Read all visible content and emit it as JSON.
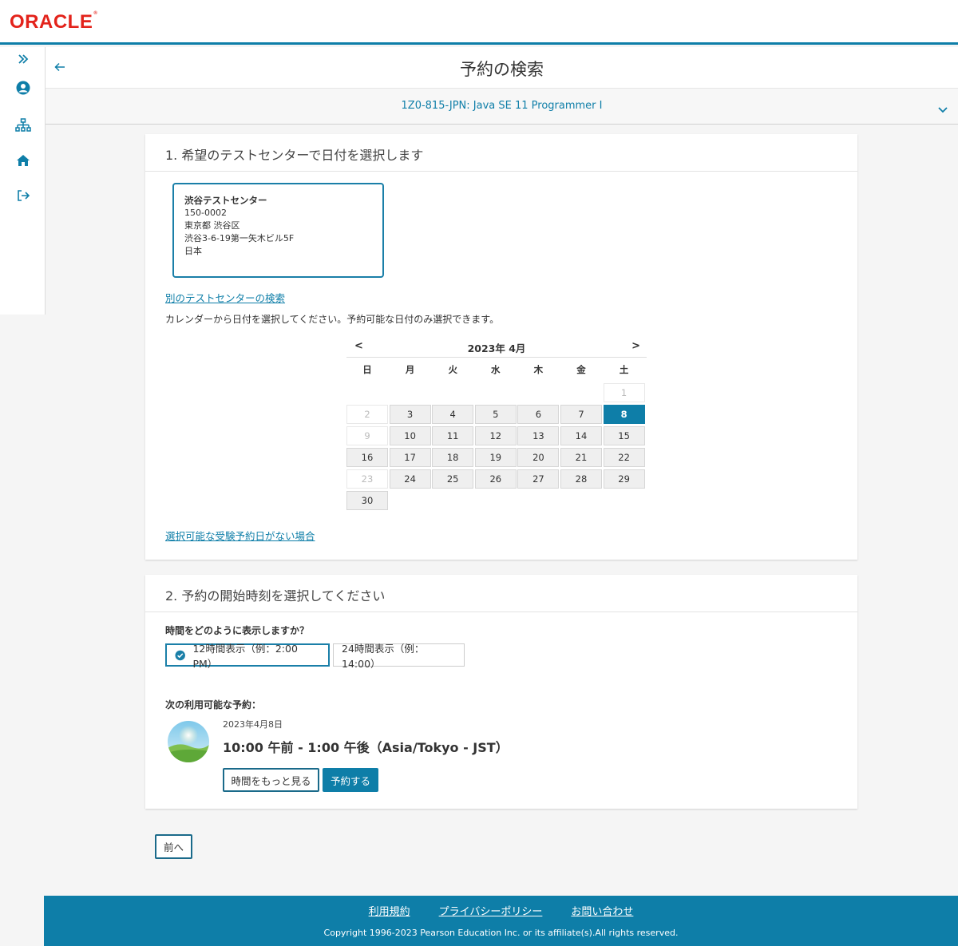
{
  "brand": {
    "logo": "ORACLE",
    "color": "#e3231b",
    "accent": "#0e7ea8"
  },
  "sidebar": {
    "items": [
      {
        "name": "expand",
        "icon": "double-chevron-right-icon"
      },
      {
        "name": "profile",
        "icon": "user-circle-icon"
      },
      {
        "name": "sitemap",
        "icon": "sitemap-icon"
      },
      {
        "name": "home",
        "icon": "home-icon"
      },
      {
        "name": "logout",
        "icon": "sign-out-icon"
      }
    ]
  },
  "header": {
    "title": "予約の検索",
    "back_icon": "arrow-left-icon"
  },
  "exam": {
    "name": "1Z0-815-JPN: Java SE 11 Programmer I",
    "chevron_icon": "chevron-down-icon"
  },
  "step1": {
    "heading": "1. 希望のテストセンターで日付を選択します",
    "center": {
      "name": "渋谷テストセンター",
      "postal": "150-0002",
      "city": "東京都 渋谷区",
      "address": "渋谷3-6-19第一矢木ビル5F",
      "country": "日本"
    },
    "search_other_link": "別のテストセンターの検索",
    "instruction": "カレンダーから日付を選択してください。予約可能な日付のみ選択できます。",
    "no_date_link": "選択可能な受験予約日がない場合"
  },
  "calendar": {
    "prev": "<",
    "next": ">",
    "month_label": "2023年 4月",
    "weekdays": [
      "日",
      "月",
      "火",
      "水",
      "木",
      "金",
      "土"
    ],
    "selected_day": "8",
    "days": [
      {
        "label": "1",
        "state": "disabled"
      },
      {
        "label": "2",
        "state": "disabled"
      },
      {
        "label": "3",
        "state": "available"
      },
      {
        "label": "4",
        "state": "available"
      },
      {
        "label": "5",
        "state": "available"
      },
      {
        "label": "6",
        "state": "available"
      },
      {
        "label": "7",
        "state": "available"
      },
      {
        "label": "8",
        "state": "selected"
      },
      {
        "label": "9",
        "state": "disabled"
      },
      {
        "label": "10",
        "state": "available"
      },
      {
        "label": "11",
        "state": "available"
      },
      {
        "label": "12",
        "state": "available"
      },
      {
        "label": "13",
        "state": "available"
      },
      {
        "label": "14",
        "state": "available"
      },
      {
        "label": "15",
        "state": "available"
      },
      {
        "label": "16",
        "state": "available"
      },
      {
        "label": "17",
        "state": "available"
      },
      {
        "label": "18",
        "state": "available"
      },
      {
        "label": "19",
        "state": "available"
      },
      {
        "label": "20",
        "state": "available"
      },
      {
        "label": "21",
        "state": "available"
      },
      {
        "label": "22",
        "state": "available"
      },
      {
        "label": "23",
        "state": "disabled"
      },
      {
        "label": "24",
        "state": "available"
      },
      {
        "label": "25",
        "state": "available"
      },
      {
        "label": "26",
        "state": "available"
      },
      {
        "label": "27",
        "state": "available"
      },
      {
        "label": "28",
        "state": "available"
      },
      {
        "label": "29",
        "state": "available"
      },
      {
        "label": "30",
        "state": "available"
      }
    ]
  },
  "step2": {
    "heading": "2. 予約の開始時刻を選択してください",
    "format_question": "時間をどのように表示しますか？",
    "format_12": "12時間表示（例：2:00 PM）",
    "format_24": "24時間表示（例：14:00）",
    "next_label": "次の利用可能な予約：",
    "date": "2023年4月8日",
    "time": "10:00 午前 - 1:00 午後（Asia/Tokyo - JST）",
    "more_button": "時間をもっと見る",
    "book_button": "予約する"
  },
  "nav": {
    "prev_button": "前へ"
  },
  "footer": {
    "links": [
      "利用規約",
      "プライバシーポリシー",
      "お問い合わせ"
    ],
    "copyright": "Copyright 1996-2023 Pearson Education Inc. or its affiliate(s).All rights reserved."
  }
}
